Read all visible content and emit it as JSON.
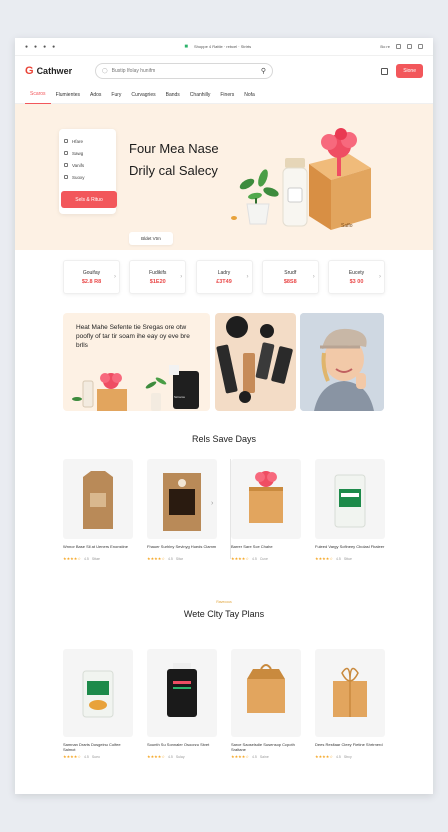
{
  "topbar": {
    "left_icons": [
      "facebook-icon",
      "twitter-icon",
      "instagram-icon",
      "pinterest-icon"
    ],
    "promo": "Shoppe 4 Rattle · rebcel · Strirts",
    "right_text": "Bo re"
  },
  "header": {
    "logo": "Cathwer",
    "search_placeholder": "Bustip Ifolay hunifm",
    "signin_label": "Sione"
  },
  "nav": {
    "items": [
      "Scaros",
      "Flumientes",
      "Ados",
      "Fury",
      "Curvagries",
      "Bands",
      "Chanhilly",
      "Finers",
      "Nofa"
    ],
    "active": 0
  },
  "hero": {
    "menu": [
      "Hfare",
      "Sawg",
      "Vanifs",
      "Suoxy"
    ],
    "cta": "Sels & Rituo",
    "title": [
      "Four Mea Nase",
      "Drily cal Salecy"
    ],
    "button": "Bldet Vtrn",
    "box_label": "Saffo"
  },
  "categories": [
    {
      "name": "Gouifay",
      "price": "$2.8 R8"
    },
    {
      "name": "Fudikifs",
      "price": "$1E20"
    },
    {
      "name": "Ladry",
      "price": "£3T49"
    },
    {
      "name": "Srudf",
      "price": "$8S8"
    },
    {
      "name": "Eucety",
      "price": "$3 00"
    }
  ],
  "promo": {
    "text": "Heat Mahe Sefente tie Sregas ore otw poofly of tar tir soam ihe eay oy eve bre brlls",
    "jar_label": "Sicrams"
  },
  "section1": {
    "title": "Rels Save Days",
    "products": [
      {
        "name": "Wnnor Base Sil at Ueners Enonstine",
        "rating": "4.5",
        "meta": "Sttae"
      },
      {
        "name": "Fhauer Surhlny Sevlnyg Hueds Clamm",
        "rating": "4.5",
        "meta": "Sitar"
      },
      {
        "name": "Barrer Sare Sce Chahe",
        "rating": "4.5",
        "meta": "Cuve"
      },
      {
        "name": "Fuleed Vargy Soflneey Cbolasl Fbaleer",
        "rating": "4.5",
        "meta": "Sttue"
      }
    ]
  },
  "section2": {
    "eyebrow": "Ravecous",
    "title": "Wete Clty Tay Plans",
    "products": [
      {
        "name": "Samnan Drarts Dosgeinu Colfee Salmot",
        "rating": "4.5",
        "meta": "Sueo"
      },
      {
        "name": "Sounth Su Sonnaler Osoorzu Stvet",
        "rating": "4.5",
        "meta": "Sulay"
      },
      {
        "name": "Sarce Saoselsdie Susensop Ccpoth Sraltane",
        "rating": "4.5",
        "meta": "Saine"
      },
      {
        "name": "Dees Resfiaar Cleey Fietine Shrtrnerd",
        "rating": "4.5",
        "meta": "Strcy"
      }
    ]
  },
  "colors": {
    "accent": "#f2575b",
    "hero_bg": "#fdf1e4",
    "kraft": "#e2a55e",
    "ribbon": "#ef4d63"
  }
}
